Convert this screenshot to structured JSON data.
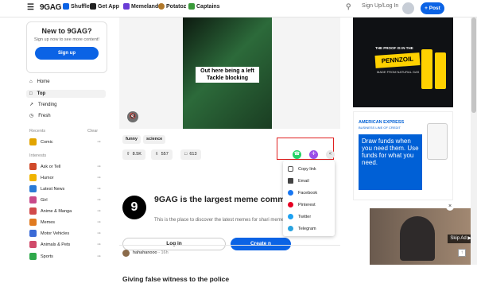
{
  "topbar": {
    "logo": "9GAG",
    "links": [
      "Shuffle",
      "Get App",
      "Memeland",
      "Potatoz",
      "Captains"
    ],
    "signin": "Sign Up/Log In",
    "post": "Post"
  },
  "sidebar": {
    "promo_title": "New to 9GAG?",
    "promo_text": "Sign up now to see more content!",
    "signup": "Sign up",
    "nav": [
      "Home",
      "Top",
      "Trending",
      "Fresh"
    ],
    "recents_label": "Recents",
    "clear_label": "Clear",
    "recents": [
      "Comic"
    ],
    "interests_label": "Interests",
    "interests": [
      "Ask or Tell",
      "Humor",
      "Latest News",
      "Girl",
      "Anime & Manga",
      "Memes",
      "Motor Vehicles",
      "Animals & Pets",
      "Sports"
    ]
  },
  "post": {
    "caption": "Out here being a left Tackle blocking",
    "tags": [
      "funny",
      "science"
    ],
    "upvotes": "8.5K",
    "downvotes": "557",
    "comments": "613"
  },
  "share_menu": [
    "Copy link",
    "Email",
    "Facebook",
    "Pinterest",
    "Twitter",
    "Telegram"
  ],
  "promo": {
    "title": "9GAG is the largest meme commu internet",
    "text": "This is the place to discover the latest memes for shari meme collection.",
    "login": "Log in",
    "create": "Create n"
  },
  "next_post": {
    "author": "hahahanooo",
    "time": "16h",
    "title": "Giving false witness to the police"
  },
  "ads": {
    "pennzoil_tag": "THE PROOF IS IN THE",
    "pennzoil": "PENNZOIL",
    "pennzoil_sub": "MADE FROM NATURAL GAS",
    "amex": "AMERICAN EXPRESS",
    "amex_sub": "BUSINESS LINE OF CREDIT",
    "amex_text": "Draw funds when you need them. Use funds for what you need.",
    "skip": "Skip Ad"
  }
}
